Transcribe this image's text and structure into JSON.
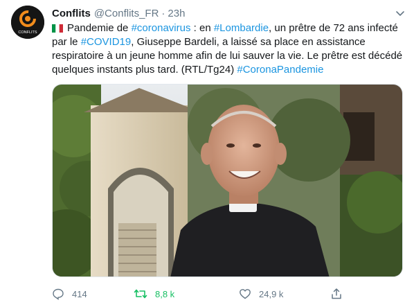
{
  "tweet": {
    "author_name": "Conflits",
    "handle": "@Conflits_FR",
    "separator": "·",
    "time": "23h",
    "avatar_text": "CONFLITS",
    "text_parts": [
      {
        "t": "Pandemie de ",
        "link": false
      },
      {
        "t": "#coronavirus",
        "link": true
      },
      {
        "t": " : en ",
        "link": false
      },
      {
        "t": "#Lombardie",
        "link": true
      },
      {
        "t": ", un prêtre de 72 ans infecté par le ",
        "link": false
      },
      {
        "t": "#COVID19",
        "link": true
      },
      {
        "t": ", Giuseppe Bardeli, a laissé sa place en assistance respiratoire à un jeune homme afin de lui sauver la vie. Le prêtre est décédé quelques instants plus tard. (RTL/Tg24) ",
        "link": false
      },
      {
        "t": "#CoronaPandemie",
        "link": true
      }
    ],
    "flag": "italy-flag",
    "media_description": "photo",
    "actions": {
      "replies": "414",
      "retweets": "8,8 k",
      "likes": "24,9 k"
    }
  },
  "colors": {
    "link": "#1b95e0",
    "muted": "#657786",
    "retweet": "#17bf63",
    "text": "#14171a"
  }
}
